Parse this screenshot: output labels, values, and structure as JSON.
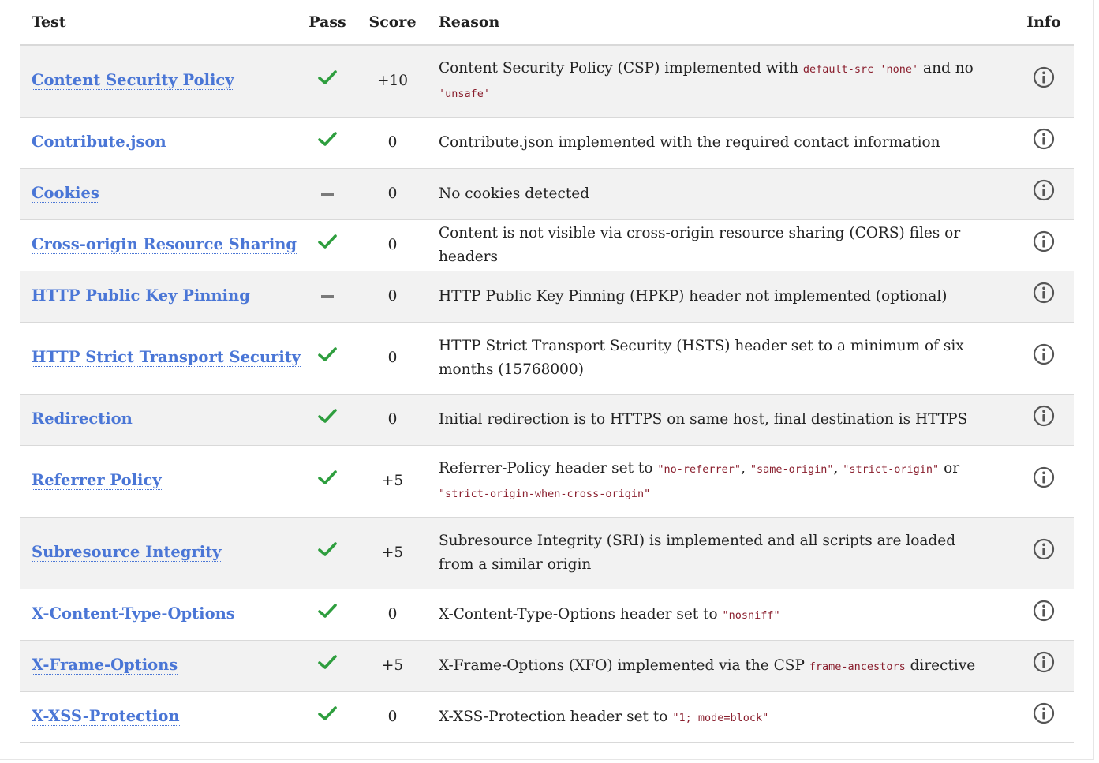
{
  "headers": {
    "test": "Test",
    "pass": "Pass",
    "score": "Score",
    "reason": "Reason",
    "info": "Info"
  },
  "colors": {
    "link": "#4a76d6",
    "pass_check": "#2e9e3e",
    "neutral_dash": "#7a7a7a",
    "code": "#8a1f2e",
    "row_alt": "#f2f2f2"
  },
  "rows": [
    {
      "test": "Content Security Policy",
      "pass": "check",
      "score": "+10",
      "reason": [
        {
          "t": "Content Security Policy (CSP) implemented with "
        },
        {
          "c": "default-src 'none'"
        },
        {
          "t": " and no "
        },
        {
          "c": "'unsafe'"
        }
      ]
    },
    {
      "test": "Contribute.json",
      "pass": "check",
      "score": "0",
      "reason": [
        {
          "t": "Contribute.json implemented with the required contact information"
        }
      ]
    },
    {
      "test": "Cookies",
      "pass": "dash",
      "score": "0",
      "reason": [
        {
          "t": "No cookies detected"
        }
      ]
    },
    {
      "test": "Cross-origin Resource Sharing",
      "pass": "check",
      "score": "0",
      "reason": [
        {
          "t": "Content is not visible via cross-origin resource sharing (CORS) files or headers"
        }
      ]
    },
    {
      "test": "HTTP Public Key Pinning",
      "pass": "dash",
      "score": "0",
      "reason": [
        {
          "t": "HTTP Public Key Pinning (HPKP) header not implemented (optional)"
        }
      ]
    },
    {
      "test": "HTTP Strict Transport Security",
      "pass": "check",
      "score": "0",
      "reason": [
        {
          "t": "HTTP Strict Transport Security (HSTS) header set to a minimum of six months (15768000)"
        }
      ]
    },
    {
      "test": "Redirection",
      "pass": "check",
      "score": "0",
      "reason": [
        {
          "t": "Initial redirection is to HTTPS on same host, final destination is HTTPS"
        }
      ]
    },
    {
      "test": "Referrer Policy",
      "pass": "check",
      "score": "+5",
      "reason": [
        {
          "t": "Referrer-Policy header set to "
        },
        {
          "c": "\"no-referrer\""
        },
        {
          "t": ", "
        },
        {
          "c": "\"same-origin\""
        },
        {
          "t": ", "
        },
        {
          "c": "\"strict-origin\""
        },
        {
          "t": " or "
        },
        {
          "c": "\"strict-origin-when-cross-origin\""
        }
      ]
    },
    {
      "test": "Subresource Integrity",
      "pass": "check",
      "score": "+5",
      "reason": [
        {
          "t": "Subresource Integrity (SRI) is implemented and all scripts are loaded from a similar origin"
        }
      ]
    },
    {
      "test": "X-Content-Type-Options",
      "pass": "check",
      "score": "0",
      "reason": [
        {
          "t": "X-Content-Type-Options header set to "
        },
        {
          "c": "\"nosniff\""
        }
      ]
    },
    {
      "test": "X-Frame-Options",
      "pass": "check",
      "score": "+5",
      "reason": [
        {
          "t": "X-Frame-Options (XFO) implemented via the CSP "
        },
        {
          "c": "frame-ancestors"
        },
        {
          "t": " directive"
        }
      ]
    },
    {
      "test": "X-XSS-Protection",
      "pass": "check",
      "score": "0",
      "reason": [
        {
          "t": "X-XSS-Protection header set to "
        },
        {
          "c": "\"1; mode=block\""
        }
      ]
    }
  ]
}
